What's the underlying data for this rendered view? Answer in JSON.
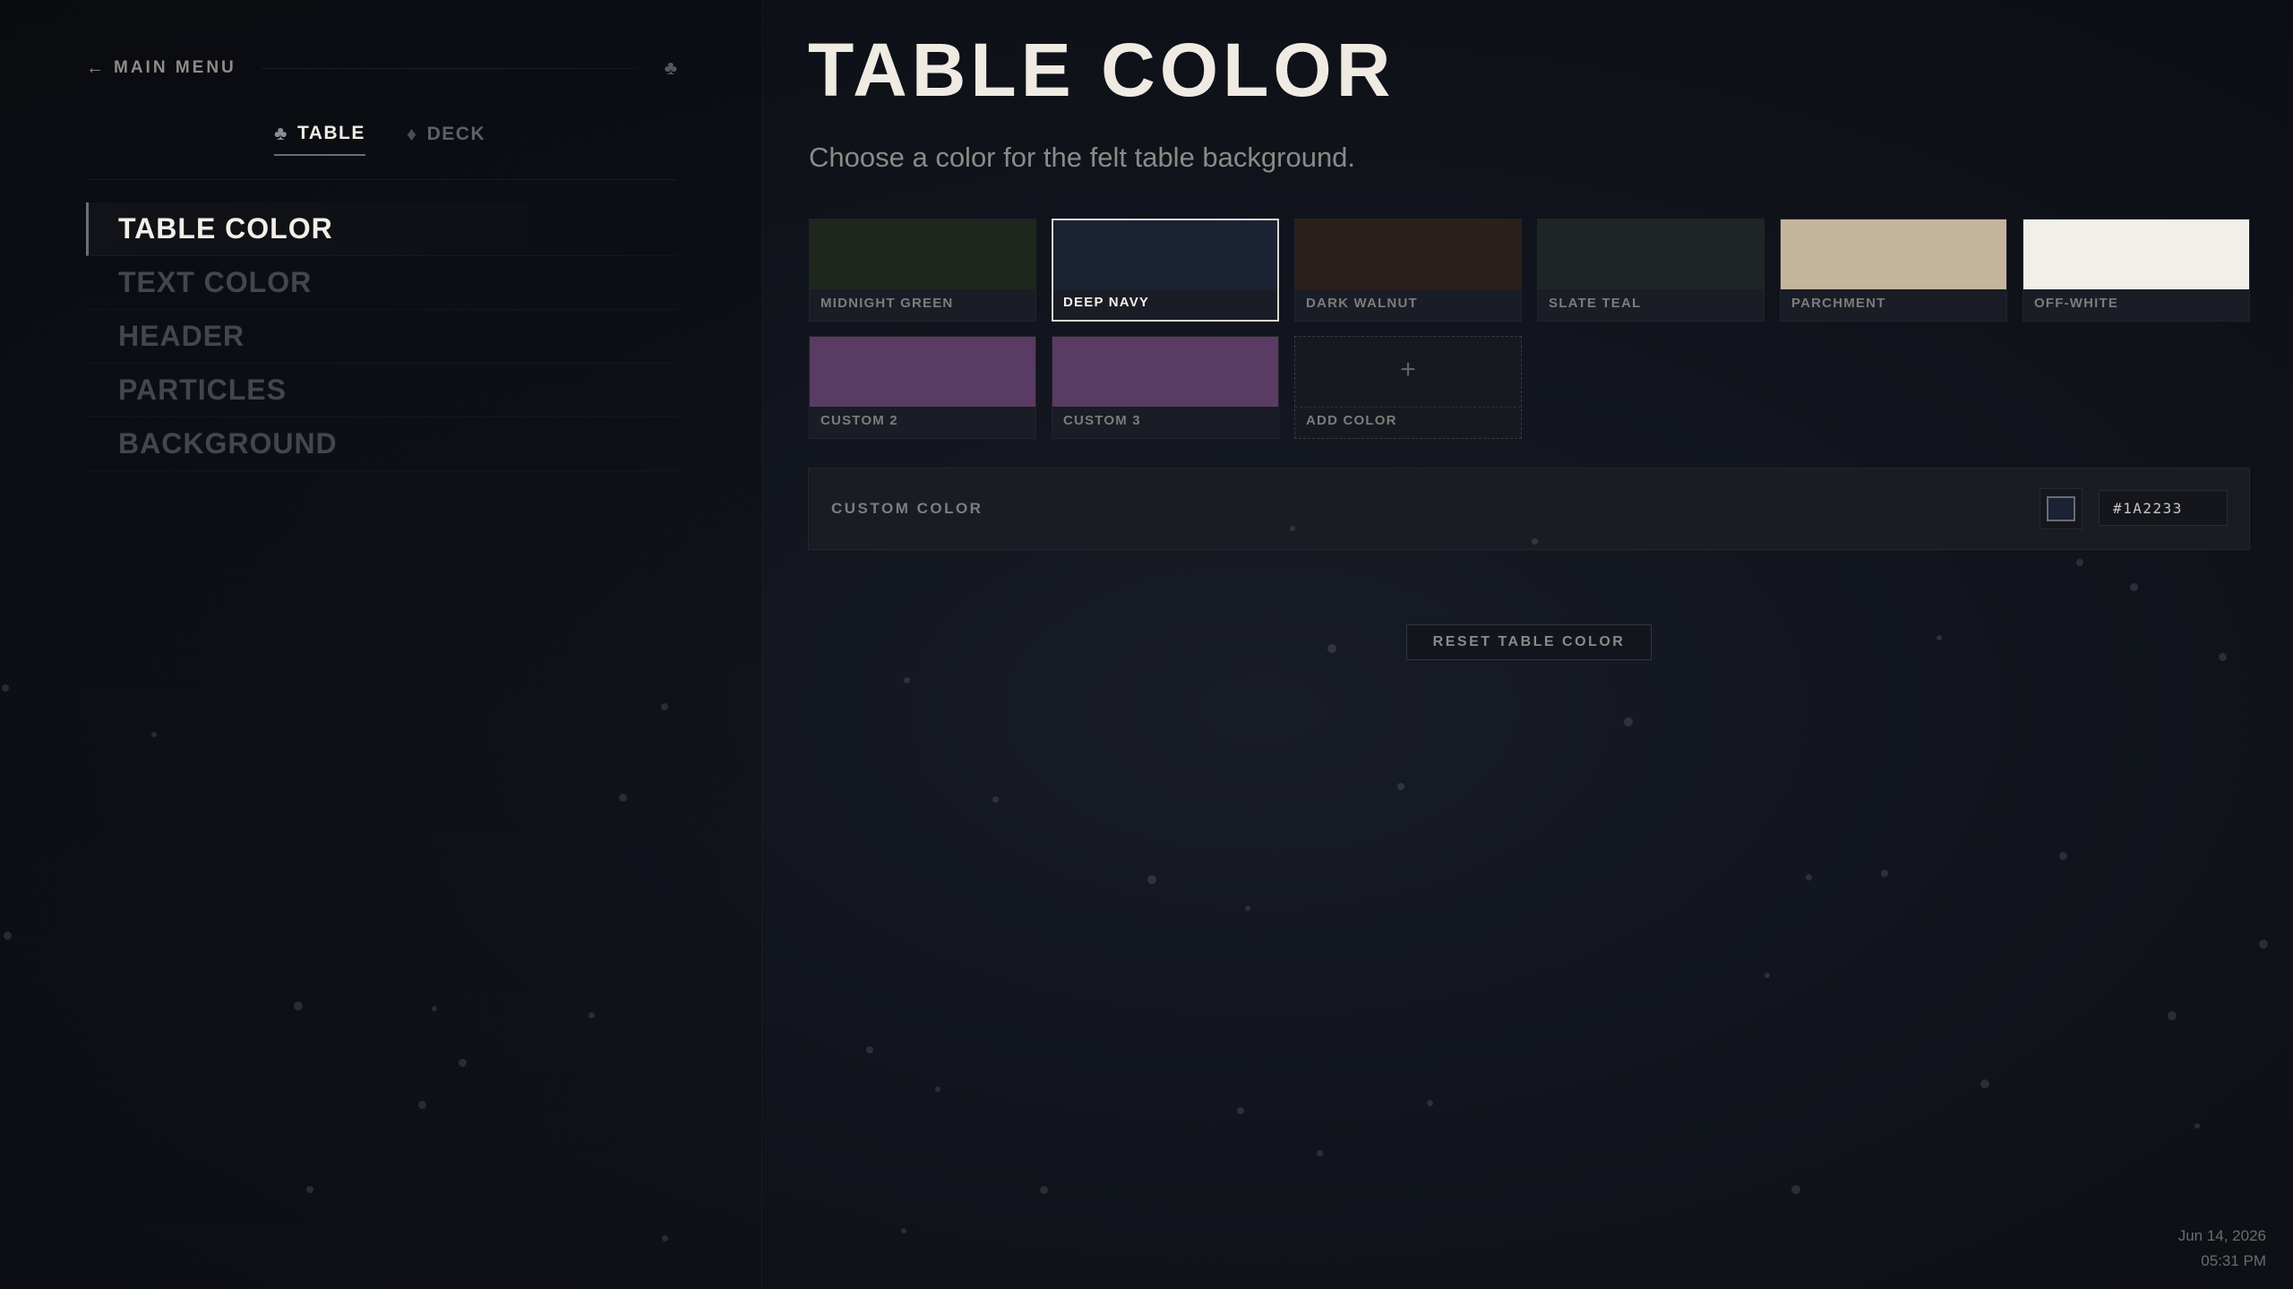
{
  "sidebar": {
    "back_label": "MAIN MENU",
    "tabs": [
      {
        "label": "TABLE",
        "icon": "club-icon",
        "active": true
      },
      {
        "label": "DECK",
        "icon": "diamond-icon",
        "active": false
      }
    ],
    "menu": [
      {
        "label": "TABLE COLOR",
        "active": true
      },
      {
        "label": "TEXT COLOR",
        "active": false
      },
      {
        "label": "HEADER",
        "active": false
      },
      {
        "label": "PARTICLES",
        "active": false
      },
      {
        "label": "BACKGROUND",
        "active": false
      }
    ]
  },
  "main": {
    "title": "TABLE COLOR",
    "subtitle": "Choose a color for the felt table background.",
    "swatches": [
      {
        "label": "MIDNIGHT GREEN",
        "color": "#1f271f"
      },
      {
        "label": "DEEP NAVY",
        "color": "#1a2233",
        "selected": true
      },
      {
        "label": "DARK WALNUT",
        "color": "#2a1f1b"
      },
      {
        "label": "SLATE TEAL",
        "color": "#1d2624"
      },
      {
        "label": "PARCHMENT",
        "color": "#c5b59c"
      },
      {
        "label": "OFF-WHITE",
        "color": "#f2efea"
      },
      {
        "label": "CUSTOM 2",
        "color": "#5a3b63"
      },
      {
        "label": "CUSTOM 3",
        "color": "#5a3b63"
      }
    ],
    "add_color": {
      "label": "ADD COLOR",
      "symbol": "+"
    },
    "custom_color": {
      "label": "CUSTOM COLOR",
      "hex": "#1A2233"
    },
    "reset_label": "RESET TABLE COLOR"
  },
  "footer": {
    "date": "Jun 14, 2026",
    "time": "05:31 PM"
  },
  "colors": {
    "background": "#11141c",
    "title": "#efebe3",
    "selected_border": "#d8d6d2"
  }
}
